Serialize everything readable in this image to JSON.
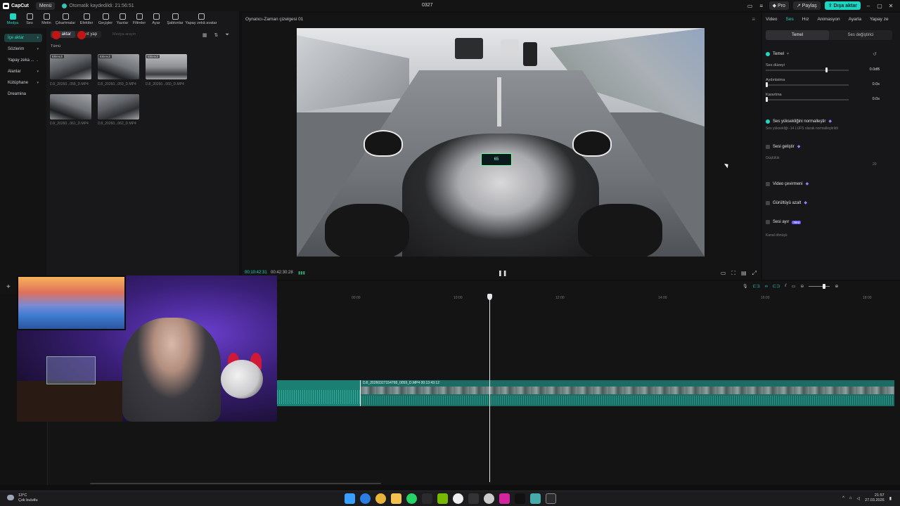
{
  "titlebar": {
    "app_name": "CapCut",
    "menu_label": "Menü",
    "autosave": "Otomatik kaydedildi: 21:56:51",
    "project_name": "0327",
    "pro_label": "Pro",
    "share_label": "Paylaş",
    "export_label": "Dışa aktar"
  },
  "tools": [
    {
      "label": "Medya",
      "icon": "media-icon",
      "active": true
    },
    {
      "label": "Ses",
      "icon": "audio-icon"
    },
    {
      "label": "Metin",
      "icon": "text-icon"
    },
    {
      "label": "Çıkartmalar",
      "icon": "sticker-icon"
    },
    {
      "label": "Efektler",
      "icon": "effects-icon"
    },
    {
      "label": "Geçişler",
      "icon": "transitions-icon"
    },
    {
      "label": "Yazılar",
      "icon": "captions-icon"
    },
    {
      "label": "Filtreler",
      "icon": "filters-icon"
    },
    {
      "label": "Ayar",
      "icon": "adjust-icon"
    },
    {
      "label": "Şablonlar",
      "icon": "templates-icon"
    },
    {
      "label": "Yapay zekâ avatar",
      "icon": "ai-avatar-icon"
    }
  ],
  "leftnav": [
    {
      "label": "İçe aktar",
      "active": true
    },
    {
      "label": "Sözlerim"
    },
    {
      "label": "Yapay zeka ..."
    },
    {
      "label": "Alanlar"
    },
    {
      "label": "Kütüphane"
    },
    {
      "label": "Dreamina"
    }
  ],
  "media": {
    "import_label": "İçe aktar",
    "record_label": "Kayıt yap",
    "search_placeholder": "Medya arayın",
    "group_label": "Tümü",
    "clips": [
      {
        "name": "DJI_20260...058_D.MP4",
        "badge": "Eklendi"
      },
      {
        "name": "DJI_20260...059_D.MP4",
        "badge": "Eklendi"
      },
      {
        "name": "DJI_20260...060_D.MP4",
        "badge": "Eklendi"
      },
      {
        "name": "DJI_20260...061_D.MP4",
        "badge": ""
      },
      {
        "name": "DJI_20260...062_D.MP4",
        "badge": ""
      }
    ]
  },
  "player": {
    "title": "Oynatıcı-Zaman çizelgesi 01",
    "current_time": "00:10:42:31",
    "total_time": "00:42:30:28",
    "dash_text": "65"
  },
  "rightpanel": {
    "tabs": [
      "Video",
      "Ses",
      "Hız",
      "Animasyon",
      "Ayarla",
      "Yapay ze"
    ],
    "active_tab": "Ses",
    "subtabs": [
      "Temel",
      "Ses değiştirici"
    ],
    "section_basic": "Temel",
    "volume_label": "Ses düzeyi",
    "volume_value": "0.0dB",
    "volume_level": 0.72,
    "fadein_label": "Aydınlatma",
    "fadein_value": "0.0s",
    "fadeout_label": "Karartma",
    "fadeout_value": "0.0s",
    "normalize_label": "Ses yüksekliğini normalleştir",
    "normalize_sub": "Ses yüksekliği -14 LUFS olarak normalleştirildi",
    "enhance_label": "Sesi geliştir",
    "enhance_sub": "Güçlülük",
    "enhance_value": "20",
    "vtranslate_label": "Video çevirmeni",
    "denoise_label": "Gürültüyü azalt",
    "separate_label": "Sesi ayır",
    "new_badge": "Yeni",
    "channel_label": "Kanal dönüşü"
  },
  "timeline": {
    "ruler": [
      "00:00",
      "10:00",
      "12:00",
      "14:00",
      "16:00",
      "18:00"
    ],
    "clip_label": "DJI_20260327154768_0059_D.MP4  00:13:43:12"
  },
  "taskbar": {
    "temp": "13°C",
    "weather": "Çok bulutlu",
    "time": "21:57",
    "date": "27.03.2026"
  },
  "colors": {
    "accent": "#21d6c4",
    "clip_teal": "#1b6d64"
  }
}
